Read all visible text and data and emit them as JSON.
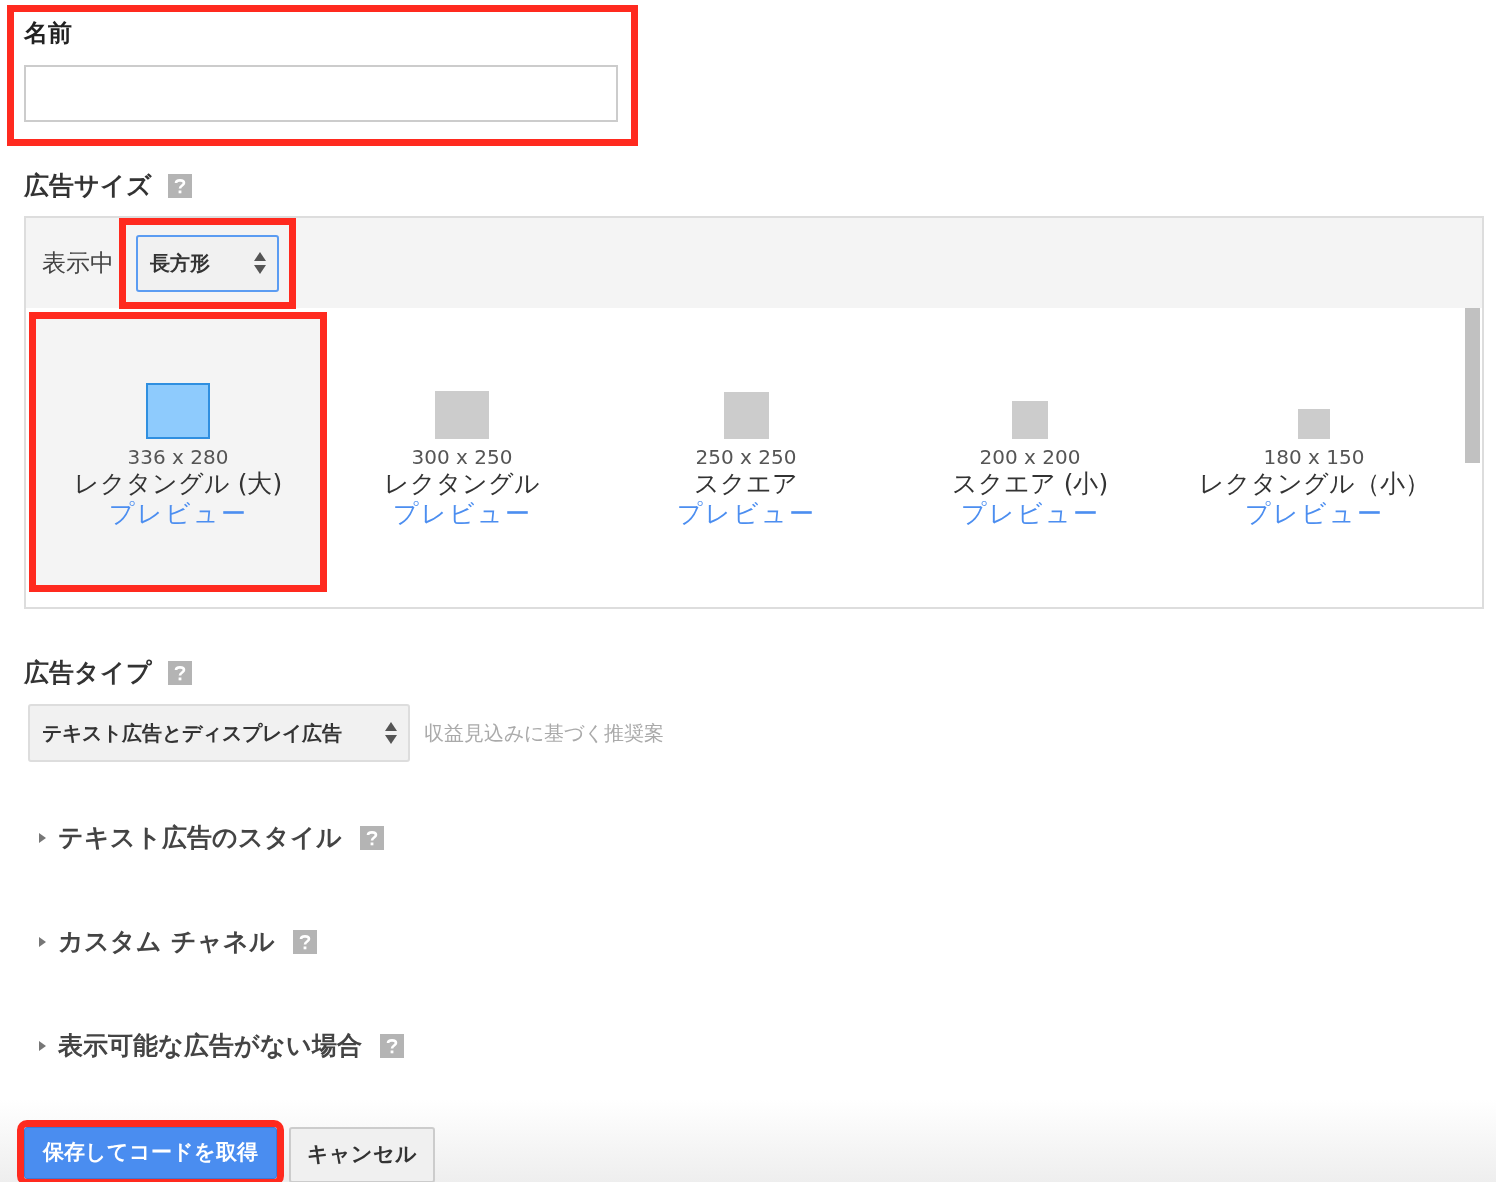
{
  "name_field": {
    "label": "名前",
    "highlighted": true
  },
  "ad_size": {
    "heading": "広告サイズ",
    "display_label": "表示中",
    "display_select": {
      "value": "長方形",
      "highlighted": true
    },
    "sizes": [
      {
        "dimensions": "336 x 280",
        "name": "レクタングル (大)",
        "link": "プレビュー",
        "selected": true,
        "highlighted": true
      },
      {
        "dimensions": "300 x 250",
        "name": "レクタングル",
        "link": "プレビュー",
        "selected": false,
        "highlighted": false
      },
      {
        "dimensions": "250 x 250",
        "name": "スクエア",
        "link": "プレビュー",
        "selected": false,
        "highlighted": false
      },
      {
        "dimensions": "200 x 200",
        "name": "スクエア (小)",
        "link": "プレビュー",
        "selected": false,
        "highlighted": false
      },
      {
        "dimensions": "180 x 150",
        "name": "レクタングル（小）",
        "link": "プレビュー",
        "selected": false,
        "highlighted": false
      }
    ]
  },
  "ad_type": {
    "heading": "広告タイプ",
    "select": "テキスト広告とディスプレイ広告",
    "hint": "収益見込みに基づく推奨案"
  },
  "sections": [
    {
      "label": "テキスト広告のスタイル",
      "expanded": false
    },
    {
      "label": "カスタム チャネル",
      "expanded": false
    },
    {
      "label": "表示可能な広告がない場合",
      "expanded": false
    }
  ],
  "buttons": [
    {
      "kind": "primary",
      "label": "保存してコードを取得",
      "highlighted": true
    },
    {
      "kind": "secondary",
      "label": "キャンセル",
      "highlighted": false
    }
  ]
}
